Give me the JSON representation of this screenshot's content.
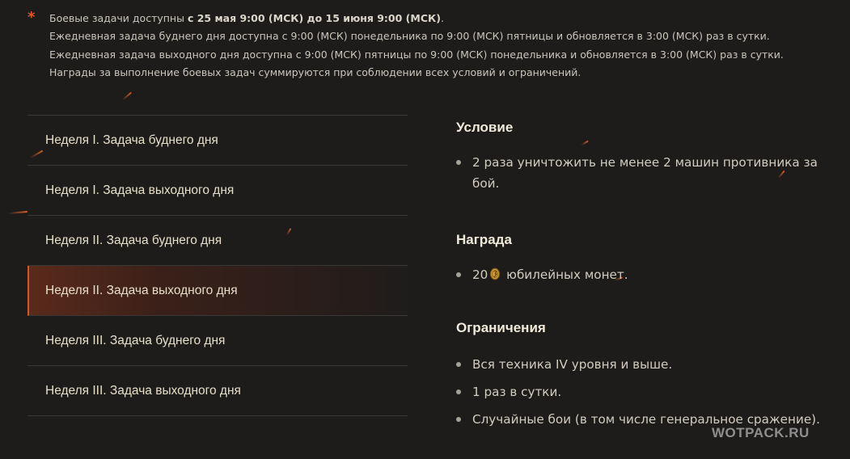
{
  "notes": {
    "star": "*",
    "line1_prefix": "Боевые задачи доступны ",
    "line1_bold": "с 25 мая 9:00 (МСК) до 15 июня 9:00 (МСК)",
    "line1_suffix": ".",
    "line2": "Ежедневная задача буднего дня доступна с 9:00 (МСК) понедельника по 9:00 (МСК) пятницы и обновляется в 3:00 (МСК) раз в сутки.",
    "line3": "Ежедневная задача выходного дня доступна с 9:00 (МСК) пятницы по 9:00 (МСК) понедельника и обновляется в 3:00 (МСК) раз в сутки.",
    "line4": "Награды за выполнение боевых задач суммируются при соблюдении всех условий и ограничений."
  },
  "tasks": [
    {
      "label": "Неделя I. Задача буднего дня"
    },
    {
      "label": "Неделя I. Задача выходного дня"
    },
    {
      "label": "Неделя II. Задача буднего дня"
    },
    {
      "label": "Неделя II. Задача выходного дня"
    },
    {
      "label": "Неделя III. Задача буднего дня"
    },
    {
      "label": "Неделя III. Задача выходного дня"
    }
  ],
  "active_task_index": 3,
  "detail": {
    "condition": {
      "title": "Условие",
      "items": [
        "2 раза уничтожить не менее 2 машин противника за бой."
      ]
    },
    "reward": {
      "title": "Награда",
      "amount": "20",
      "coin_icon": "jubilee-coin-icon",
      "text": "юбилейных монет."
    },
    "limits": {
      "title": "Ограничения",
      "items": [
        "Вся техника IV уровня и выше.",
        "1 раз в сутки.",
        "Случайные бои (в том числе генеральное сражение)."
      ]
    }
  },
  "watermark": "WOTPACK.RU",
  "colors": {
    "background": "#1d1c1b",
    "accent": "#d4552a",
    "title": "#f1ead8",
    "text": "#d2ccbe"
  }
}
